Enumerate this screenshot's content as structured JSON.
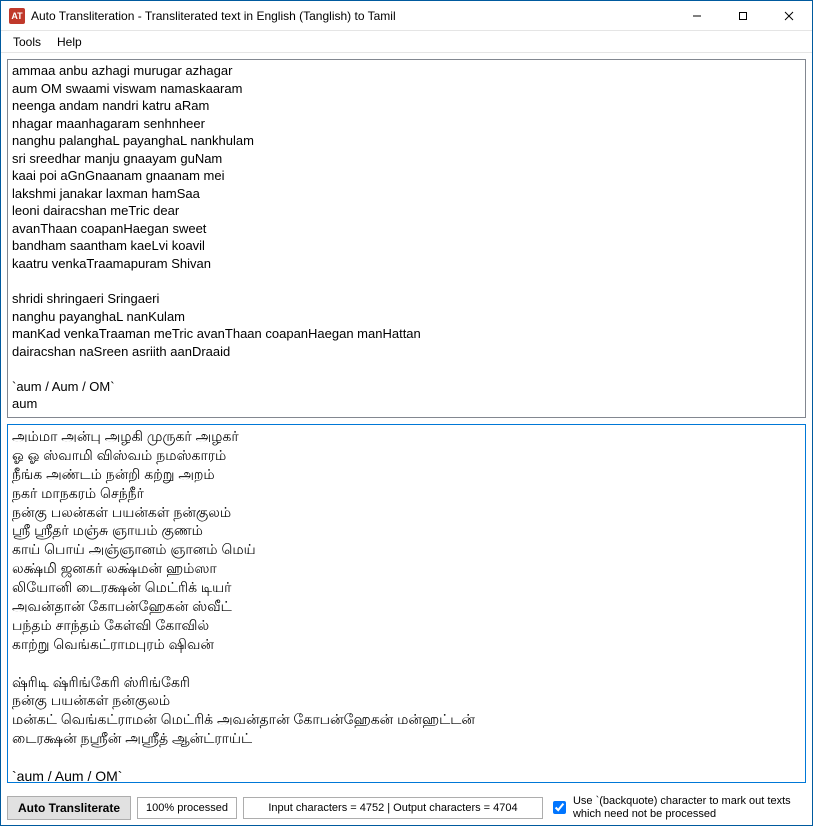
{
  "window": {
    "icon_text": "AT",
    "title": "Auto Transliteration - Transliterated text in English (Tanglish) to Tamil"
  },
  "menu": {
    "tools": "Tools",
    "help": "Help"
  },
  "input_text": "ammaa anbu azhagi murugar azhagar\naum OM swaami viswam namaskaaram\nneenga andam nandri katru aRam\nnhagar maanhagaram senhnheer\nnanghu palanghaL payanghaL nankhulam\nsri sreedhar manju gnaayam guNam\nkaai poi aGnGnaanam gnaanam mei\nlakshmi janakar laxman hamSaa\nleoni dairacshan meTric dear\navanThaan coapanHaegan sweet\nbandham saantham kaeLvi koavil\nkaatru venkaTraamapuram Shivan\n\nshridi shringaeri Sringaeri\nnanghu payanghaL nanKulam\nmanKad venkaTraaman meTric avanThaan coapanHaegan manHattan\ndairacshan naSreen asriith aanDraaid\n\n`aum / Aum / OM`\naum\n\n`Vowels` (uyir ezhuththukkaL)\na, aa/A, i, ee/I/ii, u, oo/uu/U",
  "output_text": "அம்மா அன்பு அழகி முருகர் அழகர்\nஓ ஓ ஸ்வாமி விஸ்வம் நமஸ்காரம்\nநீங்க அண்டம் நன்றி கற்று அறம்\nநகர் மாநகரம் செந்நீர்\nநன்கு பலன்கள் பயன்கள் நன்குலம்\nஸ்ரீ ஸ்ரீதர் மஞ்சு ஞாயம் குணம்\nகாய் பொய் அஞ்ஞானம் ஞானம் மெய்\nலக்ஷ்மி ஜனகர் லக்ஷ்மன் ஹம்ஸா\nலியோனி டைரக்ஷன் மெட்ரிக் டியர்\nஅவன்தான் கோபன்ஹேகன் ஸ்வீட்\nபந்தம் சாந்தம் கேள்வி கோவில்\nகாற்று வெங்கட்ராமபுரம் ஷிவன்\n\nஷ்ரிடி ஷ்ரிங்கேரி ஸ்ரிங்கேரி\nநன்கு பயன்கள் நன்குலம்\nமன்கட் வெங்கட்ராமன் மெட்ரிக் அவன்தான் கோபன்ஹேகன் மன்ஹட்டன்\nடைரக்ஷன் நஸ்ரீன் அஸ்ரீத் ஆன்ட்ராய்ட்\n\n`aum / Aum / OM`\nஓ",
  "bottom": {
    "button": "Auto Transliterate",
    "progress": "100% processed",
    "counts": "Input characters  = 4752  |  Output characters = 4704",
    "checkbox_label": "Use `(backquote) character to mark out texts which need not be processed",
    "checkbox_checked": true
  }
}
